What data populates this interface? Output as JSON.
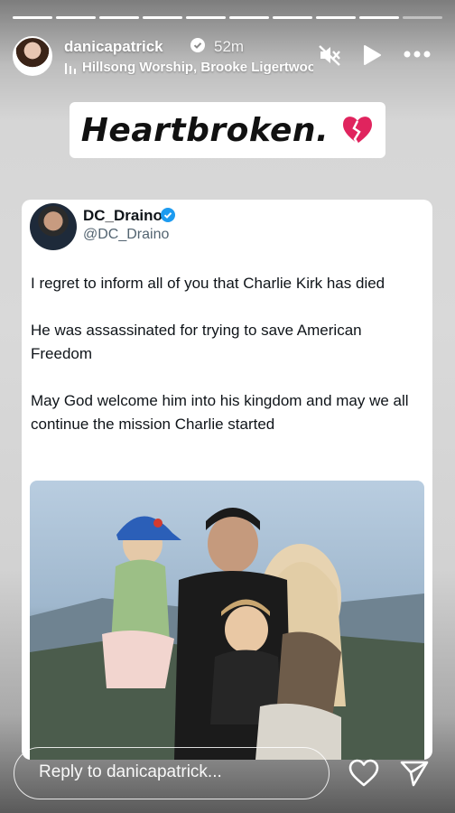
{
  "progress": {
    "total": 10,
    "completed": 9
  },
  "header": {
    "username": "danicapatrick",
    "time_ago": "52m",
    "music": "Hillsong Worship, Brooke Ligertwood"
  },
  "sticker": {
    "text": "Heartbroken."
  },
  "tweet": {
    "name": "DC_Draino",
    "handle": "@DC_Draino",
    "paragraphs": [
      "I regret to inform all of you that Charlie Kirk has died",
      "He was assassinated for trying to save American Freedom",
      "May God welcome him into his kingdom and may we all continue the mission Charlie started"
    ]
  },
  "reply": {
    "placeholder": "Reply to danicapatrick..."
  },
  "icons": {
    "mute": "speaker-muted-icon",
    "play": "play-icon",
    "more": "more-dots-icon",
    "like": "heart-outline-icon",
    "share": "send-icon"
  },
  "colors": {
    "verified": "#1d9bf0",
    "heart": "#e0245e"
  }
}
